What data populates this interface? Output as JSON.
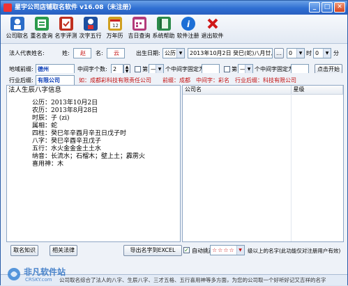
{
  "window": {
    "title": "星宇公司店铺取名软件 v16.08（未注册）"
  },
  "toolbar": [
    {
      "label": "公司取名",
      "icon": "company-naming-icon",
      "color": "#2a6cc8"
    },
    {
      "label": "重名查询",
      "icon": "duplicate-search-icon",
      "color": "#2a9a4c"
    },
    {
      "label": "名字评测",
      "icon": "name-evaluate-icon",
      "color": "#c03020"
    },
    {
      "label": "次字五行",
      "icon": "five-elements-icon",
      "color": "#1c4fa0"
    },
    {
      "label": "万年历",
      "icon": "calendar-icon",
      "color": "#d0a020"
    },
    {
      "label": "吉日查询",
      "icon": "lucky-day-icon",
      "color": "#b33a7a"
    },
    {
      "label": "系统帮助",
      "icon": "help-book-icon",
      "color": "#2c8a4a"
    },
    {
      "label": "软件注册",
      "icon": "info-register-icon",
      "color": "#1d6fd6"
    },
    {
      "label": "退出软件",
      "icon": "exit-icon",
      "color": "#d01818"
    }
  ],
  "legal": {
    "label": "法人代表姓名:",
    "surname_label": "姓:",
    "surname": "赵",
    "given_label": "名:",
    "given": "云",
    "birth_label": "出生日期:",
    "calendar_type": "公历",
    "birth_date": "2013年10月2日 癸巳(蛇)八月廿八",
    "hour": "0",
    "hour_label": "时",
    "minute": "0",
    "minute_label": "分"
  },
  "prefix": {
    "region_label": "地域前缀:",
    "region": "德州",
    "middle_count_label": "中间字个数:",
    "middle_count": "2",
    "fix1_prefix": "第",
    "fix1_pos": "—",
    "fix1_suffix": "个中间字固定为",
    "fix2_prefix": "第",
    "fix2_pos": "—",
    "fix2_suffix": "个中间字固定为",
    "start_button": "点击开始"
  },
  "industry": {
    "label": "行业后缀:",
    "value": "有限公司",
    "example_text": "如：成都彩科技有限责任公司　　前缀：成都　中间字：彩名　行业后缀：科技有限公司"
  },
  "bazi": {
    "title": "法人生辰八字信息",
    "lines": [
      "公历：2013年10月2日",
      "农历：2013年8月28日",
      "时辰：子 (zi)",
      "属相：蛇",
      "四柱：癸巳年辛酉月辛丑日戊子时",
      "八字：癸巳辛酉辛丑戊子",
      "五行：水火金金金土土水",
      "纳音：长流水；石榴木；壁上土；霹雳火",
      "喜用神：木"
    ]
  },
  "results": {
    "columns": [
      "公司名",
      "星级"
    ]
  },
  "bottom": {
    "naming_knowledge": "取名知识",
    "related_law": "相关法律",
    "export_excel": "导出名字到EXCEL",
    "auto_filter": "自动挑选",
    "star_filter": "级以上的名字(此功能仅对注册用户有效)"
  },
  "status": "公司取名综合了法人的八字、生辰八字、三才五格、五行喜用神等多方面，为您的公司取一个好听好记又吉祥的名字",
  "watermark": {
    "cn": "非凡软件站",
    "en": "CRSKY.com"
  }
}
